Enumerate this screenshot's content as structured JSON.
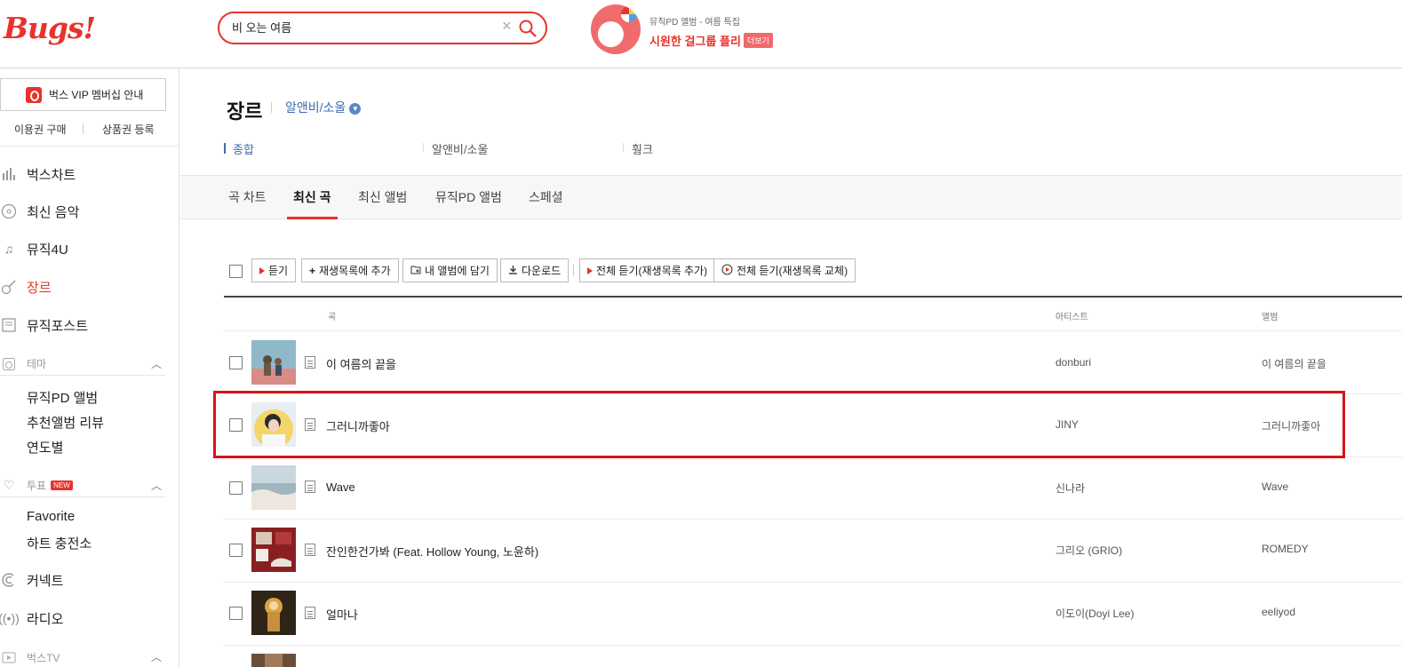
{
  "header": {
    "logo": "Bugs!",
    "search": {
      "value": "비 오는 여름",
      "placeholder": ""
    },
    "promo": {
      "subtitle": "뮤직PD 앨범 - 여름 특집",
      "title": "시원한 걸그룹 플리",
      "more": "더보기"
    }
  },
  "sidebar": {
    "vip": "벅스 VIP 멤버십 안내",
    "buy": "이용권 구매",
    "voucher": "상품권 등록",
    "nav": [
      "벅스차트",
      "최신 음악",
      "뮤직4U",
      "장르",
      "뮤직포스트"
    ],
    "theme": {
      "label": "테마",
      "items": [
        "뮤직PD 앨범",
        "추천앨범 리뷰",
        "연도별"
      ]
    },
    "vote": {
      "label": "투표",
      "badge": "NEW",
      "items": [
        "Favorite",
        "하트 충전소"
      ]
    },
    "more_nav": [
      "커넥트",
      "라디오"
    ],
    "tv": {
      "label": "벅스TV"
    }
  },
  "genre": {
    "title": "장르",
    "selected": "알앤비/소울",
    "subcats": [
      "종합",
      "알앤비/소울",
      "훵크"
    ]
  },
  "tabs": [
    "곡 차트",
    "최신 곡",
    "최신 앨범",
    "뮤직PD 앨범",
    "스페셜"
  ],
  "toolbar": {
    "play": "듣기",
    "add_playlist": "재생목록에 추가",
    "add_album": "내 앨범에 담기",
    "download": "다운로드",
    "play_all_add": "전체 듣기(재생목록 추가)",
    "play_all_replace": "전체 듣기(재생목록 교체)"
  },
  "table": {
    "headers": {
      "song": "곡",
      "artist": "아티스트",
      "album": "앨범"
    },
    "rows": [
      {
        "title": "이 여름의 끝을",
        "artist": "donburi",
        "album": "이 여름의 끝을"
      },
      {
        "title": "그러니까좋아",
        "artist": "JINY",
        "album": "그러니까좋아"
      },
      {
        "title": "Wave",
        "artist": "신나라",
        "album": "Wave"
      },
      {
        "title": "잔인한건가봐 (Feat. Hollow Young, 노윤하)",
        "artist": "그리오 (GRIO)",
        "album": "ROMEDY"
      },
      {
        "title": "얼마나",
        "artist": "이도이(Doyi Lee)",
        "album": "eeliyod"
      }
    ]
  },
  "colors": {
    "accent": "#e8322b",
    "link": "#3d6bb3",
    "highlight": "#d7141a"
  }
}
